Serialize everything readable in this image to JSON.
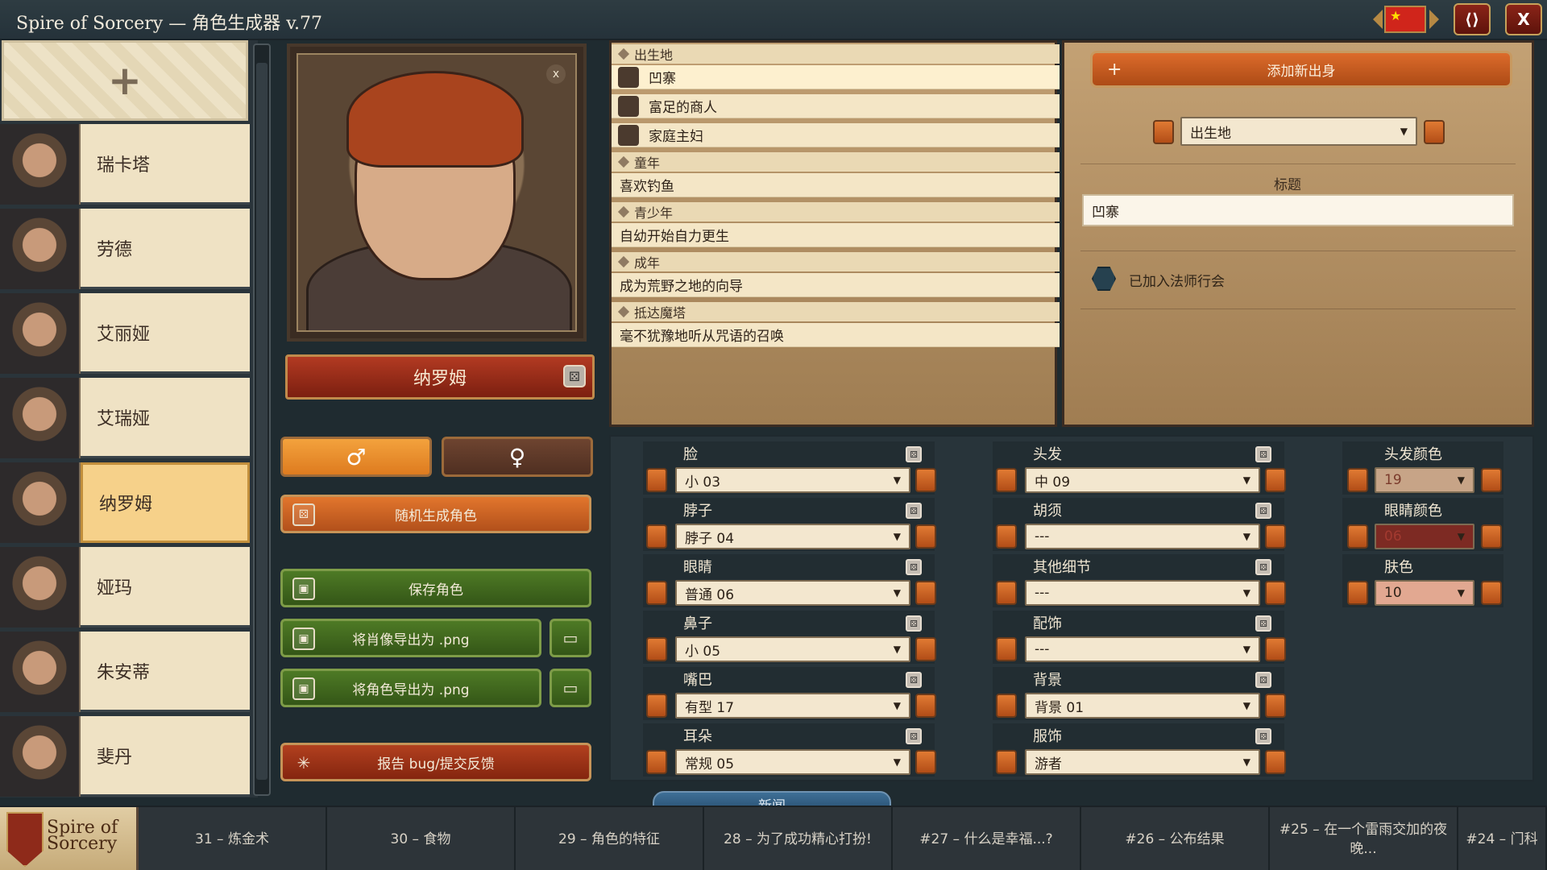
{
  "window": {
    "title": "Spire of Sorcery — 角色生成器 v.77",
    "close_label": "X"
  },
  "roster": {
    "add_label": "+",
    "characters": [
      {
        "name": "瑞卡塔"
      },
      {
        "name": "劳德"
      },
      {
        "name": "艾丽娅"
      },
      {
        "name": "艾瑞娅"
      },
      {
        "name": "纳罗姆",
        "selected": true
      },
      {
        "name": "娅玛"
      },
      {
        "name": "朱安蒂"
      },
      {
        "name": "斐丹"
      }
    ]
  },
  "portrait": {
    "close_label": "x",
    "character_name": "纳罗姆"
  },
  "gender": {
    "male_symbol": "♂",
    "female_symbol": "♀",
    "selected": "male"
  },
  "actions": {
    "random_label": "随机生成角色",
    "save_label": "保存角色",
    "export_portrait_label": "将肖像导出为 .png",
    "export_character_label": "将角色导出为 .png",
    "report_label": "报告 bug/提交反馈"
  },
  "story": {
    "sections": [
      {
        "header": "出生地",
        "items": [
          "凹寨",
          "富足的商人",
          "家庭主妇"
        ]
      },
      {
        "header": "童年",
        "items": [
          "喜欢钓鱼"
        ]
      },
      {
        "header": "青少年",
        "items": [
          "自幼开始自力更生"
        ]
      },
      {
        "header": "成年",
        "items": [
          "成为荒野之地的向导"
        ]
      },
      {
        "header": "抵达魔塔",
        "items": [
          "毫不犹豫地听从咒语的召唤"
        ]
      }
    ]
  },
  "editor": {
    "add_origin_label": "添加新出身",
    "category_value": "出生地",
    "title_label": "标题",
    "title_value": "凹寨",
    "mage_guild_label": "已加入法师行会"
  },
  "features": {
    "left": [
      {
        "label": "脸",
        "value": "小 03"
      },
      {
        "label": "脖子",
        "value": "脖子 04"
      },
      {
        "label": "眼睛",
        "value": "普通 06"
      },
      {
        "label": "鼻子",
        "value": "小 05"
      },
      {
        "label": "嘴巴",
        "value": "有型 17"
      },
      {
        "label": "耳朵",
        "value": "常规 05"
      }
    ],
    "middle": [
      {
        "label": "头发",
        "value": "中 09"
      },
      {
        "label": "胡须",
        "value": "---"
      },
      {
        "label": "其他细节",
        "value": "---"
      },
      {
        "label": "配饰",
        "value": "---"
      },
      {
        "label": "背景",
        "value": "背景 01"
      },
      {
        "label": "服饰",
        "value": "游者"
      }
    ],
    "colors": [
      {
        "label": "头发颜色",
        "value": "19"
      },
      {
        "label": "眼睛颜色",
        "value": "06"
      },
      {
        "label": "肤色",
        "value": "10"
      }
    ]
  },
  "news": {
    "tab_label": "新闻",
    "logo_text": "Spire of Sorcery",
    "items": [
      "31 – 炼金术",
      "30 – 食物",
      "29 – 角色的特征",
      "28 – 为了成功精心打扮!",
      "#27 – 什么是幸福...?",
      "#26 – 公布结果",
      "#25 – 在一个雷雨交加的夜晚...",
      "#24 – 门科"
    ]
  },
  "colors": {
    "accent_orange": "#d8692a",
    "accent_green": "#4e7a25",
    "accent_red": "#a8331a"
  }
}
